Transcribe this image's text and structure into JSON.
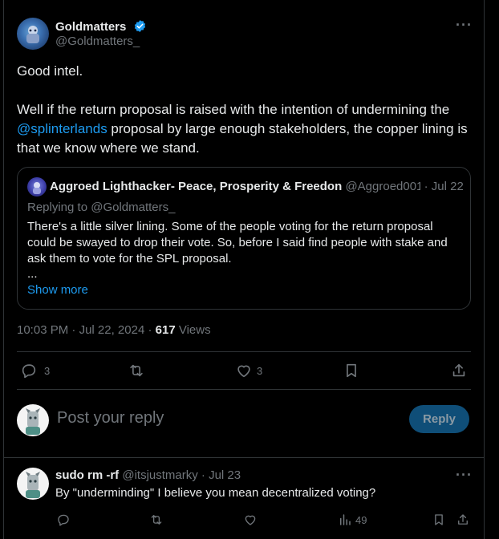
{
  "tweet": {
    "author_name": "Goldmatters",
    "author_handle": "@Goldmatters_",
    "text_line1": "Good intel.",
    "text_p2_a": "Well if the return proposal is raised with the intention of undermining the",
    "mention": "@splinterlands",
    "text_p2_b": " proposal by large enough stakeholders, the copper lining is that we know where we stand.",
    "time": "10:03 PM",
    "date": "Jul 22, 2024",
    "views_count": "617",
    "views_label": "Views",
    "reply_count": "3",
    "like_count": "3"
  },
  "quote": {
    "author_name": "Aggroed Lighthacker- Peace, Prosperity & Freedon",
    "author_handle": "@Aggroed001",
    "date": "Jul 22",
    "replying_to": "Replying to @Goldmatters_",
    "text_1": "There's a little silver lining.  Some of the people voting for the return proposal could be swayed to drop their vote. So, before I said find people with stake and ask them to vote for the SPL proposal.",
    "ellipsis": "...",
    "show_more": "Show more"
  },
  "composer": {
    "placeholder": "Post your reply",
    "reply_button": "Reply"
  },
  "reply": {
    "author_name": "sudo rm -rf",
    "author_handle": "@itsjustmarky",
    "date": "Jul 23",
    "text": "By \"underminding\" I believe you mean decentralized voting?",
    "views_count": "49"
  },
  "colors": {
    "accent": "#1d9bf0",
    "background": "#000000",
    "muted": "#71767b",
    "border": "#2f3336",
    "reply_button_bg": "#0f4e78"
  }
}
